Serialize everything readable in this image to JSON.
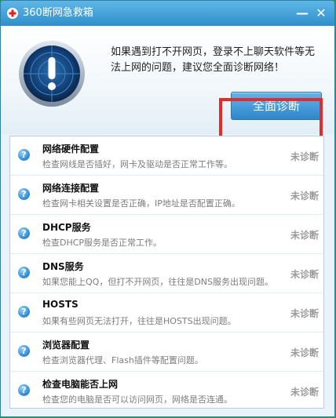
{
  "window": {
    "title": "360断网急救箱"
  },
  "titlebar": {
    "minimize_label": "—",
    "close_label": "✕"
  },
  "header": {
    "description": "如果遇到打不开网页，登录不上聊天软件等无法上网的问题，建议您全面诊断网络！",
    "diagnose_button": "全面诊断"
  },
  "items": [
    {
      "title": "网络硬件配置",
      "desc": "检查网线是否插好，网卡及驱动是否正常工作等。",
      "status": "未诊断"
    },
    {
      "title": "网络连接配置",
      "desc": "检查网卡相关设置是否正确，IP地址是否配置正确。",
      "status": "未诊断"
    },
    {
      "title": "DHCP服务",
      "desc": "检查DHCP服务是否正常工作。",
      "status": "未诊断"
    },
    {
      "title": "DNS服务",
      "desc": "如果您能上QQ，但打不开网页，往往是DNS服务出现问题。",
      "status": "未诊断"
    },
    {
      "title": "HOSTS",
      "desc": "如果有些网页无法打开，往往是HOSTS出现问题。",
      "status": "未诊断"
    },
    {
      "title": "浏览器配置",
      "desc": "检查浏览器代理、Flash插件等配置问题。",
      "status": "未诊断"
    },
    {
      "title": "检查电脑能否上网",
      "desc": "检查您的电脑是否可以访问网页，网络是否连通。",
      "status": "未诊断"
    }
  ],
  "icons": {
    "app_logo": "red-cross-icon",
    "status_icon": "question-icon",
    "hero_icon": "radar-warning-icon"
  },
  "colors": {
    "titlebar": "#3d9fda",
    "accent_button": "#2f86c9",
    "highlight": "#e62a2a",
    "status_text": "#9a9a9a"
  }
}
